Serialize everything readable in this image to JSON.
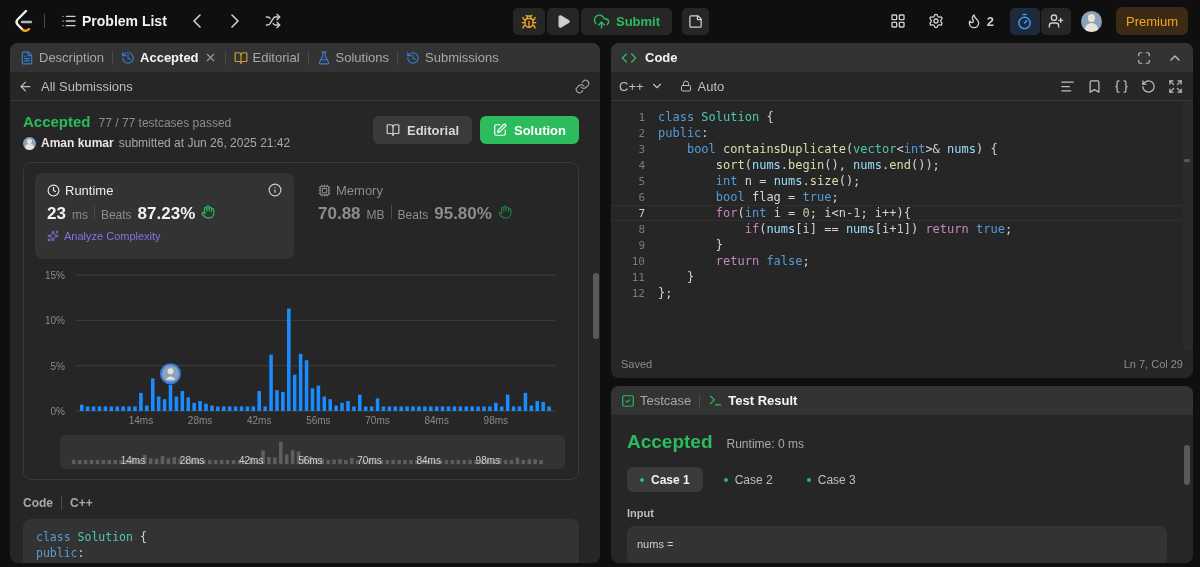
{
  "topbar": {
    "nav_title": "Problem List",
    "submit": "Submit",
    "streak": "2",
    "timer_active": true,
    "premium": "Premium"
  },
  "left_panel": {
    "tabs": [
      {
        "label": "Description",
        "selected": false,
        "closable": false
      },
      {
        "label": "Accepted",
        "selected": true,
        "closable": true
      },
      {
        "label": "Editorial",
        "selected": false,
        "closable": false
      },
      {
        "label": "Solutions",
        "selected": false,
        "closable": false
      },
      {
        "label": "Submissions",
        "selected": false,
        "closable": false
      }
    ],
    "back_link": "All Submissions",
    "submission": {
      "status": "Accepted",
      "testcases": "77 / 77 testcases passed",
      "author": "Aman kumar",
      "submitted": "submitted at Jun 26, 2025 21:42",
      "buttons": [
        {
          "label": "Editorial",
          "kind": "secondary"
        },
        {
          "label": "Solution",
          "kind": "primary"
        }
      ]
    },
    "metrics": [
      {
        "kind": "runtime",
        "label": "Runtime",
        "value": "23",
        "unit": "ms",
        "beats_label": "Beats",
        "beats": "87.23%",
        "selected": true,
        "link": "Analyze Complexity"
      },
      {
        "kind": "memory",
        "label": "Memory",
        "value": "70.88",
        "unit": "MB",
        "beats_label": "Beats",
        "beats": "95.80%",
        "selected": false
      }
    ],
    "chart_data": {
      "type": "bar",
      "x": [
        0,
        1.4,
        2.8,
        4.2,
        5.6,
        7,
        8.4,
        9.8,
        11.2,
        12.6,
        14,
        15.4,
        16.8,
        18.2,
        19.6,
        21,
        22.4,
        23.8,
        25.2,
        26.6,
        28,
        29.4,
        30.8,
        32.2,
        33.6,
        35,
        36.4,
        37.8,
        39.2,
        40.6,
        42,
        43.4,
        44.8,
        46.2,
        47.6,
        49,
        50.4,
        51.8,
        53.2,
        54.6,
        56,
        57.4,
        58.8,
        60.2,
        61.6,
        63,
        64.4,
        65.8,
        67.2,
        68.6,
        70,
        71.4,
        72.8,
        74.2,
        75.6,
        77,
        78.4,
        79.8,
        81.2,
        82.6,
        84,
        85.4,
        86.8,
        88.2,
        89.6,
        91,
        92.4,
        93.8,
        95.2,
        96.6,
        98,
        99.4,
        100.8,
        102.2,
        103.6,
        105,
        106.4,
        107.8,
        109.2,
        110.6
      ],
      "series": [
        {
          "color": "#1a8cff",
          "values": [
            0.7,
            0.5,
            0.5,
            0.5,
            0.5,
            0.5,
            0.5,
            0.5,
            0.5,
            0.5,
            2.0,
            0.6,
            3.6,
            1.6,
            1.3,
            2.9,
            1.6,
            2.2,
            1.5,
            0.9,
            1.1,
            0.8,
            0.6,
            0.5,
            0.5,
            0.5,
            0.5,
            0.5,
            0.5,
            0.5,
            2.2,
            0.5,
            6.2,
            2.3,
            2.1,
            11.3,
            4.0,
            6.3,
            5.6,
            2.5,
            2.8,
            1.6,
            1.3,
            0.6,
            0.9,
            1.1,
            0.5,
            1.8,
            0.5,
            0.5,
            1.4,
            0.5,
            0.5,
            0.5,
            0.5,
            0.5,
            0.5,
            0.5,
            0.5,
            0.5,
            0.5,
            0.5,
            0.5,
            0.5,
            0.5,
            0.5,
            0.5,
            0.5,
            0.5,
            0.5,
            0.9,
            0.5,
            1.8,
            0.5,
            0.5,
            2.0,
            0.6,
            1.1,
            1.0,
            0.5
          ]
        }
      ],
      "xlim": [
        -1.6,
        112
      ],
      "ylim": [
        0,
        15
      ],
      "yticks": [
        {
          "value": 0,
          "label": "0%"
        },
        {
          "value": 5,
          "label": "5%"
        },
        {
          "value": 10,
          "label": "10%"
        },
        {
          "value": 15,
          "label": "15%"
        }
      ],
      "xticks": [
        {
          "value": 14,
          "label": "14ms"
        },
        {
          "value": 28,
          "label": "28ms"
        },
        {
          "value": 42,
          "label": "42ms"
        },
        {
          "value": 56,
          "label": "56ms"
        },
        {
          "value": 70,
          "label": "70ms"
        },
        {
          "value": 84,
          "label": "84ms"
        },
        {
          "value": 98,
          "label": "98ms"
        }
      ]
    },
    "overview_labels": [
      "14ms",
      "28ms",
      "42ms",
      "56ms",
      "70ms",
      "84ms",
      "98ms"
    ],
    "code_header": {
      "label": "Code",
      "language": "C++"
    },
    "code_lines": [
      [
        {
          "t": "class",
          "color": "#569cd6"
        },
        {
          "t": " Solution",
          "color": "#4ec9b0"
        },
        {
          "t": " {"
        }
      ],
      [
        {
          "t": "public",
          "color": "#569cd6"
        },
        {
          "t": ":"
        }
      ]
    ]
  },
  "editor": {
    "title": "Code",
    "language": "C++",
    "mode": "Auto",
    "status": "Saved",
    "cursor": "Ln 7, Col 29",
    "lines": [
      {
        "number": "1",
        "current": false,
        "tokens": [
          {
            "t": "class",
            "color": "#569cd6"
          },
          {
            "t": " Solution",
            "color": "#4ec9b0"
          },
          {
            "t": " {"
          }
        ]
      },
      {
        "number": "2",
        "current": false,
        "tokens": [
          {
            "t": "public",
            "color": "#569cd6"
          },
          {
            "t": ":"
          }
        ]
      },
      {
        "number": "3",
        "current": false,
        "tokens": [
          {
            "t": "    bool",
            "color": "#569cd6"
          },
          {
            "t": " containsDuplicate",
            "color": "#dcdcaa"
          },
          {
            "t": "("
          },
          {
            "t": "vector",
            "color": "#4ec9b0"
          },
          {
            "t": "<"
          },
          {
            "t": "int",
            "color": "#569cd6"
          },
          {
            "t": ">& "
          },
          {
            "t": "nums",
            "color": "#9cdcfe"
          },
          {
            "t": ") {"
          }
        ]
      },
      {
        "number": "4",
        "current": false,
        "tokens": [
          {
            "t": "        sort",
            "color": "#dcdcaa"
          },
          {
            "t": "("
          },
          {
            "t": "nums",
            "color": "#9cdcfe"
          },
          {
            "t": "."
          },
          {
            "t": "begin",
            "color": "#dcdcaa"
          },
          {
            "t": "(), "
          },
          {
            "t": "nums",
            "color": "#9cdcfe"
          },
          {
            "t": "."
          },
          {
            "t": "end",
            "color": "#dcdcaa"
          },
          {
            "t": "());"
          }
        ]
      },
      {
        "number": "5",
        "current": false,
        "tokens": [
          {
            "t": "        int",
            "color": "#569cd6"
          },
          {
            "t": " n = "
          },
          {
            "t": "nums",
            "color": "#9cdcfe"
          },
          {
            "t": "."
          },
          {
            "t": "size",
            "color": "#dcdcaa"
          },
          {
            "t": "();"
          }
        ]
      },
      {
        "number": "6",
        "current": false,
        "tokens": [
          {
            "t": "        bool",
            "color": "#569cd6"
          },
          {
            "t": " flag = "
          },
          {
            "t": "true",
            "color": "#569cd6"
          },
          {
            "t": ";"
          }
        ]
      },
      {
        "number": "7",
        "current": true,
        "tokens": [
          {
            "t": "        for",
            "color": "#c586c0"
          },
          {
            "t": "("
          },
          {
            "t": "int",
            "color": "#569cd6"
          },
          {
            "t": " i = "
          },
          {
            "t": "0",
            "color": "#b5cea8"
          },
          {
            "t": "; i<n-"
          },
          {
            "t": "1",
            "color": "#b5cea8"
          },
          {
            "t": "; i++){"
          }
        ]
      },
      {
        "number": "8",
        "current": false,
        "tokens": [
          {
            "t": "            if",
            "color": "#c586c0"
          },
          {
            "t": "("
          },
          {
            "t": "nums",
            "color": "#9cdcfe"
          },
          {
            "t": "[i] == "
          },
          {
            "t": "nums",
            "color": "#9cdcfe"
          },
          {
            "t": "[i+"
          },
          {
            "t": "1",
            "color": "#b5cea8"
          },
          {
            "t": "]) "
          },
          {
            "t": "return",
            "color": "#c586c0"
          },
          {
            "t": " true",
            "color": "#569cd6"
          },
          {
            "t": ";"
          }
        ]
      },
      {
        "number": "9",
        "current": false,
        "tokens": [
          {
            "t": "        }"
          }
        ]
      },
      {
        "number": "10",
        "current": false,
        "tokens": [
          {
            "t": "        return",
            "color": "#c586c0"
          },
          {
            "t": " false",
            "color": "#569cd6"
          },
          {
            "t": ";"
          }
        ]
      },
      {
        "number": "11",
        "current": false,
        "tokens": [
          {
            "t": "    }"
          }
        ]
      },
      {
        "number": "12",
        "current": false,
        "tokens": [
          {
            "t": "};"
          }
        ]
      }
    ]
  },
  "console": {
    "tabs": [
      {
        "label": "Testcase",
        "selected": false
      },
      {
        "label": "Test Result",
        "selected": true
      }
    ],
    "status": "Accepted",
    "runtime": "Runtime: 0 ms",
    "cases": [
      {
        "label": "Case 1",
        "selected": true,
        "passed": true
      },
      {
        "label": "Case 2",
        "selected": false,
        "passed": true
      },
      {
        "label": "Case 3",
        "selected": false,
        "passed": true
      }
    ],
    "input_label": "Input",
    "input_value": "nums ="
  }
}
